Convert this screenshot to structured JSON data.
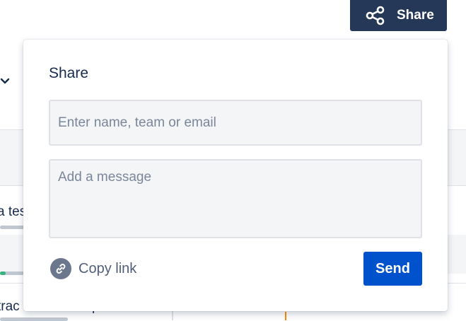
{
  "header": {
    "share_label": "Share",
    "share_icon": "share-icon"
  },
  "background": {
    "row_text_1": "a tes",
    "row_text_2": "trac",
    "row_text_3": "p",
    "chevron_icon": "chevron-down-icon"
  },
  "share_dialog": {
    "title": "Share",
    "recipient_placeholder": "Enter name, team or email",
    "recipient_value": "",
    "message_placeholder": "Add a message",
    "message_value": "",
    "copy_link_label": "Copy link",
    "copy_link_icon": "link-icon",
    "send_label": "Send"
  },
  "colors": {
    "header_button": "#253858",
    "primary": "#0052cc",
    "field_bg": "#f4f5f7",
    "field_border": "#dfe1e6",
    "link_icon_bg": "#6b778c",
    "progress_green": "#36b37e",
    "marker_orange": "#ff8b00"
  }
}
